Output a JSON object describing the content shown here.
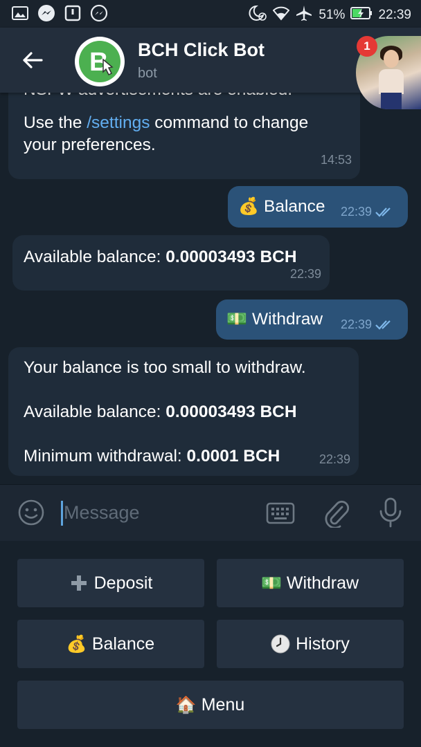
{
  "status_bar": {
    "battery": "51%",
    "time": "22:39"
  },
  "header": {
    "title": "BCH Click Bot",
    "subtitle": "bot",
    "notification_count": "1"
  },
  "messages": [
    {
      "partial_top": "NSFW advertisements are enabled.",
      "pre": "Use the ",
      "link": "/settings",
      "post": " command to change",
      "line2": "your preferences.",
      "time": "14:53"
    },
    {
      "text": "Balance",
      "time": "22:39"
    },
    {
      "label": "Available balance: ",
      "value": "0.00003493 BCH",
      "time": "22:39"
    },
    {
      "text": "Withdraw",
      "time": "22:39"
    },
    {
      "line1": "Your balance is too small to withdraw.",
      "label2": "Available balance: ",
      "value2": "0.00003493 BCH",
      "label3": "Minimum withdrawal: ",
      "value3": "0.0001 BCH",
      "time": "22:39"
    }
  ],
  "input": {
    "placeholder": "Message"
  },
  "keyboard": {
    "deposit": "Deposit",
    "withdraw": "Withdraw",
    "balance": "Balance",
    "history": "History",
    "menu": "Menu"
  },
  "colors": {
    "background": "#17212b",
    "header": "#232e3c",
    "incoming": "#1f2c3a",
    "outgoing": "#2b5278",
    "link": "#62aef0"
  }
}
